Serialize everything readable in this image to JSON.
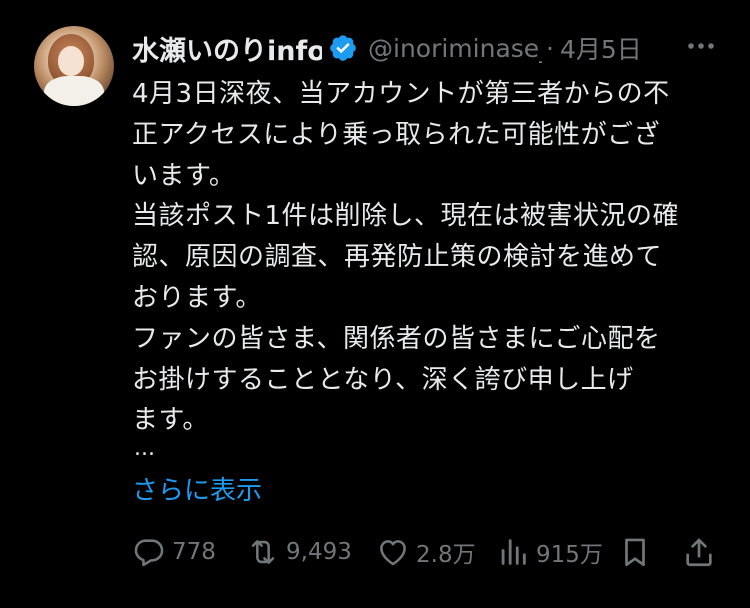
{
  "post": {
    "author": {
      "display_name": "水瀬いのりinfo",
      "handle": "@inoriminase_info",
      "verified": true
    },
    "separator": "·",
    "date": "4月5日",
    "body_lines": [
      "4月3日深夜、当アカウントが第三者からの不",
      "正アクセスにより乗っ取られた可能性がござ",
      "います。",
      "当該ポスト1件は削除し、現在は被害状況の確",
      "認、原因の調査、再発防止策の検討を進めて",
      "おります。",
      "ファンの皆さま、関係者の皆さまにご心配を",
      "お掛けすることとなり、深く誇び申し上げ",
      "ます。"
    ],
    "ellipsis": "...",
    "show_more_label": "さらに表示",
    "metrics": {
      "replies": "778",
      "reposts": "9,493",
      "likes": "2.8万",
      "views": "915万"
    },
    "icons": {
      "verified": "verified-badge-icon",
      "more": "more-dots-icon",
      "reply": "reply-bubble-icon",
      "repost": "repost-arrows-icon",
      "like": "heart-icon",
      "views": "bar-chart-icon",
      "bookmark": "bookmark-icon",
      "share": "share-upload-icon"
    },
    "colors": {
      "background": "#000000",
      "text": "#e7e9ea",
      "secondary": "#71767b",
      "accent": "#1d9bf0"
    }
  }
}
